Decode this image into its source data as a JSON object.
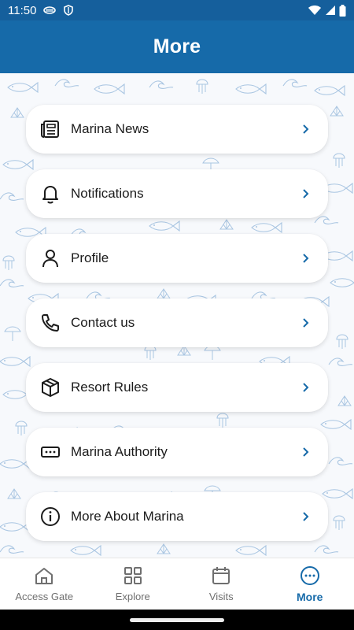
{
  "status_bar": {
    "time": "11:50",
    "icons": [
      "vpn-icon",
      "shield-icon",
      "wifi-icon",
      "signal-icon",
      "battery-icon"
    ]
  },
  "header": {
    "title": "More"
  },
  "menu": {
    "items": [
      {
        "label": "Marina News",
        "icon": "newspaper-icon"
      },
      {
        "label": "Notifications",
        "icon": "bell-icon"
      },
      {
        "label": "Profile",
        "icon": "person-icon"
      },
      {
        "label": "Contact us",
        "icon": "phone-icon"
      },
      {
        "label": "Resort Rules",
        "icon": "box-icon"
      },
      {
        "label": "Marina Authority",
        "icon": "dots-card-icon"
      },
      {
        "label": "More About Marina",
        "icon": "info-icon"
      }
    ]
  },
  "bottom_nav": {
    "items": [
      {
        "label": "Access Gate",
        "icon": "home-icon",
        "active": false
      },
      {
        "label": "Explore",
        "icon": "grid-icon",
        "active": false
      },
      {
        "label": "Visits",
        "icon": "calendar-icon",
        "active": false
      },
      {
        "label": "More",
        "icon": "more-icon",
        "active": true
      }
    ]
  },
  "colors": {
    "header_bg": "#166aa9",
    "status_bg": "#155f9c",
    "accent": "#166aa9",
    "pattern": "#aac6e2"
  }
}
